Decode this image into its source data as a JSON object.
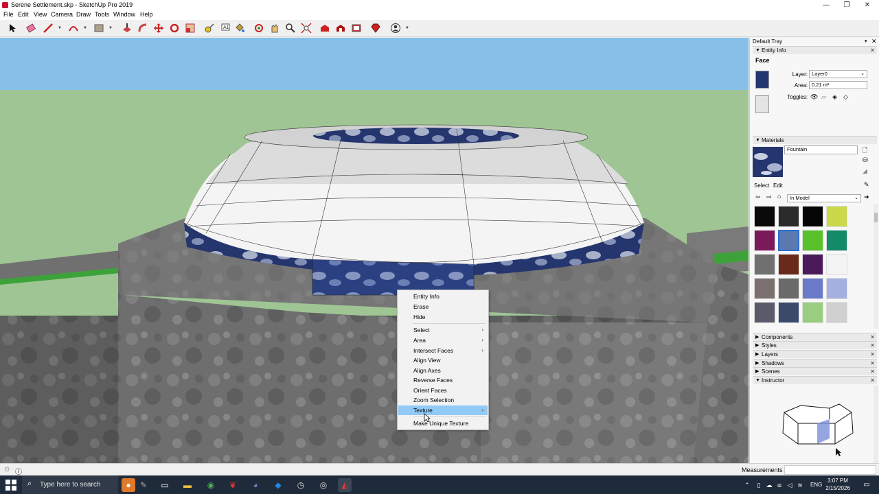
{
  "window": {
    "title": "Serene Settlement.skp - SketchUp Pro 2019",
    "minimize": "—",
    "maximize": "❐",
    "close": "✕"
  },
  "menu": [
    "File",
    "Edit",
    "View",
    "Camera",
    "Draw",
    "Tools",
    "Window",
    "Help"
  ],
  "toolbar": {
    "icons": [
      "select-icon",
      "eraser-icon",
      "pencil-icon",
      "arc-icon",
      "rectangle-icon",
      "push-pull-icon",
      "follow-me-icon",
      "move-icon",
      "rotate-icon",
      "scale-icon",
      "tape-measure-icon",
      "text-icon",
      "paint-bucket-icon",
      "orbit-icon",
      "pan-icon",
      "zoom-icon",
      "zoom-extents-icon",
      "warehouse-icon",
      "extension-warehouse-icon",
      "layout-icon",
      "ruby-icon",
      "account-icon"
    ]
  },
  "context_menu": {
    "items": [
      {
        "label": "Entity Info",
        "submenu": false
      },
      {
        "label": "Erase",
        "submenu": false
      },
      {
        "label": "Hide",
        "submenu": false
      },
      {
        "label": "Select",
        "submenu": true
      },
      {
        "label": "Area",
        "submenu": true
      },
      {
        "label": "Intersect Faces",
        "submenu": true
      },
      {
        "label": "Align View",
        "submenu": false
      },
      {
        "label": "Align Axes",
        "submenu": false
      },
      {
        "label": "Reverse Faces",
        "submenu": false
      },
      {
        "label": "Orient Faces",
        "submenu": false
      },
      {
        "label": "Zoom Selection",
        "submenu": false
      },
      {
        "label": "Texture",
        "submenu": true,
        "active": true
      },
      {
        "label": "Make Unique Texture",
        "submenu": false
      }
    ],
    "arrow": "›"
  },
  "tray": {
    "title": "Default Tray",
    "entity_info": {
      "header": "Entity Info",
      "entity_type": "Face",
      "layer_label": "Layer:",
      "layer_value": "Layer0",
      "area_label": "Area:",
      "area_value": "0.21 m²",
      "toggles_label": "Toggles:"
    },
    "materials": {
      "header": "Materials",
      "name": "Fountain",
      "tab_select": "Select",
      "tab_edit": "Edit",
      "library": "In Model",
      "swatches": [
        "#0a0a0a",
        "#2a2a2a",
        "#050505",
        "#c9d94a",
        "#7a1a5a",
        "#5a7ab0",
        "#58c02a",
        "#138a68",
        "#707070",
        "#6a2a1a",
        "#4a1a5a",
        "#f4f4f4",
        "#7a7070",
        "#6a6a6a",
        "#6a7ac8",
        "#a4b0e0",
        "#5a5a6a",
        "#3a4a6a",
        "#9acd80",
        "#d0d0d0"
      ],
      "selected_index": 5
    },
    "collapsed_panels": [
      "Components",
      "Styles",
      "Layers",
      "Shadows",
      "Scenes"
    ],
    "instructor": {
      "header": "Instructor"
    }
  },
  "statusbar": {
    "measurements_label": "Measurements"
  },
  "taskbar": {
    "search_placeholder": "Type here to search",
    "language": "ENG",
    "time": "3:07 PM",
    "date": "2/15/2026"
  },
  "colors": {
    "sky": "#86bfe8",
    "ground": "#9fc594",
    "menu_highlight": "#91c9f7",
    "selection": "#2a6fd6"
  }
}
